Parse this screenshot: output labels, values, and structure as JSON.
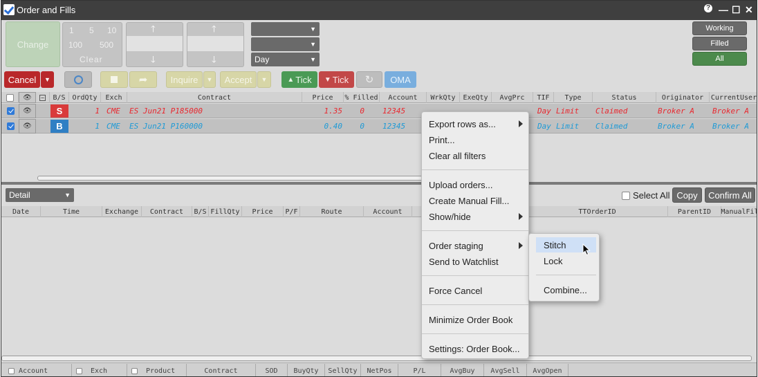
{
  "window": {
    "title": "Order and Fills",
    "help": "?",
    "minimize": "—",
    "maximize": "☐",
    "close": "✕"
  },
  "toolbar": {
    "change": "Change",
    "qty": [
      "1",
      "5",
      "10",
      "100",
      "500"
    ],
    "clear": "Clear",
    "tif": "Day",
    "cancel": "Cancel",
    "inquire": "Inquire",
    "accept": "Accept",
    "tick_up": "Tick",
    "tick_down": "Tick",
    "oma": "OMA",
    "right_buttons": [
      "Working",
      "Filled",
      "All"
    ]
  },
  "orders": {
    "columns": [
      "B/S",
      "OrdQty",
      "Exch",
      "Contract",
      "Price",
      "% Filled",
      "Account",
      "WrkQty",
      "ExeQty",
      "AvgPrc",
      "TIF",
      "Type",
      "Status",
      "Originator",
      "CurrentUser"
    ],
    "rows": [
      {
        "side": "S",
        "qty": "1",
        "exch": "CME",
        "contract": "ES Jun21 P185000",
        "price": "1.35",
        "filled": "0",
        "account": "12345",
        "tif": "Day",
        "type": "Limit",
        "status": "Claimed",
        "originator": "Broker A",
        "current": "Broker A"
      },
      {
        "side": "B",
        "qty": "1",
        "exch": "CME",
        "contract": "ES Jun21 P160000",
        "price": "0.40",
        "filled": "0",
        "account": "12345",
        "tif": "Day",
        "type": "Limit",
        "status": "Claimed",
        "originator": "Broker A",
        "current": "Broker A"
      }
    ]
  },
  "detail": {
    "view": "Detail",
    "select_all": "Select All",
    "copy": "Copy",
    "confirm_all": "Confirm All",
    "columns": [
      "Date",
      "Time",
      "Exchange",
      "Contract",
      "B/S",
      "FillQty",
      "Price",
      "P/F",
      "Route",
      "Account",
      "TTOrderID",
      "ParentID",
      "ManualFil"
    ]
  },
  "context_menu": {
    "items": [
      "Export rows as...",
      "Print...",
      "Clear all filters",
      "Upload orders...",
      "Create Manual Fill...",
      "Show/hide",
      "Order staging",
      "Send to Watchlist",
      "Force Cancel",
      "Minimize Order Book",
      "Settings: Order Book..."
    ]
  },
  "submenu": {
    "items": [
      "Stitch",
      "Lock",
      "Combine..."
    ]
  },
  "footer": {
    "tabs": [
      "Account",
      "Exch",
      "Product",
      "Contract",
      "SOD",
      "BuyQty",
      "SellQty",
      "NetPos",
      "P/L",
      "AvgBuy",
      "AvgSell",
      "AvgOpen"
    ]
  },
  "colors": {
    "sell": "#d93b3b",
    "buy": "#2f7fc4",
    "sell_text": "#e8282f",
    "buy_text": "#1e9ad6",
    "cancel": "#b9282a",
    "tick_green": "#4a9a55",
    "tick_red": "#c24848",
    "oma": "#79aede",
    "all_green": "#4c8a4c"
  }
}
